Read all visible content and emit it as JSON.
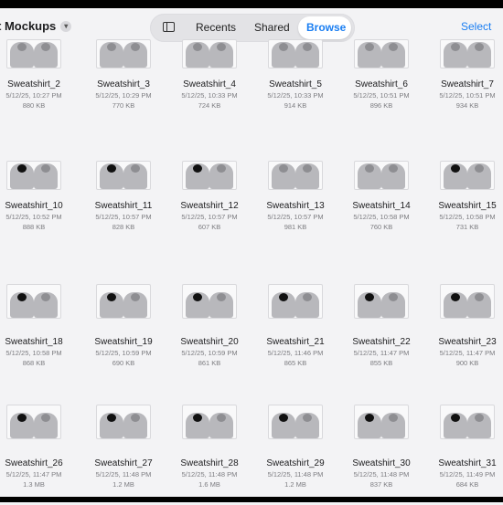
{
  "header": {
    "folder_title": "t Mockups",
    "chevron_icon": "chevron-down-icon",
    "sidebar_icon": "sidebar-icon",
    "segments": [
      "Recents",
      "Shared",
      "Browse"
    ],
    "active_segment": "Browse",
    "select_label": "Select",
    "accent_color": "#1a7ef2"
  },
  "rows": [
    [
      {
        "name": "Sweatshirt_2",
        "date": "5/12/25, 10:27 PM",
        "size": "880 KB"
      },
      {
        "name": "Sweatshirt_3",
        "date": "5/12/25, 10:29 PM",
        "size": "770 KB"
      },
      {
        "name": "Sweatshirt_4",
        "date": "5/12/25, 10:33 PM",
        "size": "724 KB"
      },
      {
        "name": "Sweatshirt_5",
        "date": "5/12/25, 10:33 PM",
        "size": "914 KB"
      },
      {
        "name": "Sweatshirt_6",
        "date": "5/12/25, 10:51 PM",
        "size": "896 KB"
      },
      {
        "name": "Sweatshirt_7",
        "date": "5/12/25, 10:51 PM",
        "size": "934 KB"
      }
    ],
    [
      {
        "name": "Sweatshirt_10",
        "date": "5/12/25, 10:52 PM",
        "size": "888 KB"
      },
      {
        "name": "Sweatshirt_11",
        "date": "5/12/25, 10:57 PM",
        "size": "828 KB"
      },
      {
        "name": "Sweatshirt_12",
        "date": "5/12/25, 10:57 PM",
        "size": "607 KB"
      },
      {
        "name": "Sweatshirt_13",
        "date": "5/12/25, 10:57 PM",
        "size": "981 KB"
      },
      {
        "name": "Sweatshirt_14",
        "date": "5/12/25, 10:58 PM",
        "size": "760 KB"
      },
      {
        "name": "Sweatshirt_15",
        "date": "5/12/25, 10:58 PM",
        "size": "731 KB"
      }
    ],
    [
      {
        "name": "Sweatshirt_18",
        "date": "5/12/25, 10:58 PM",
        "size": "868 KB"
      },
      {
        "name": "Sweatshirt_19",
        "date": "5/12/25, 10:59 PM",
        "size": "690 KB"
      },
      {
        "name": "Sweatshirt_20",
        "date": "5/12/25, 10:59 PM",
        "size": "861 KB"
      },
      {
        "name": "Sweatshirt_21",
        "date": "5/12/25, 11:46 PM",
        "size": "865 KB"
      },
      {
        "name": "Sweatshirt_22",
        "date": "5/12/25, 11:47 PM",
        "size": "855 KB"
      },
      {
        "name": "Sweatshirt_23",
        "date": "5/12/25, 11:47 PM",
        "size": "900 KB"
      }
    ],
    [
      {
        "name": "Sweatshirt_26",
        "date": "5/12/25, 11:47 PM",
        "size": "1.3 MB"
      },
      {
        "name": "Sweatshirt_27",
        "date": "5/12/25, 11:48 PM",
        "size": "1.2 MB"
      },
      {
        "name": "Sweatshirt_28",
        "date": "5/12/25, 11:48 PM",
        "size": "1.6 MB"
      },
      {
        "name": "Sweatshirt_29",
        "date": "5/12/25, 11:48 PM",
        "size": "1.2 MB"
      },
      {
        "name": "Sweatshirt_30",
        "date": "5/12/25, 11:48 PM",
        "size": "837 KB"
      },
      {
        "name": "Sweatshirt_31",
        "date": "5/12/25, 11:49 PM",
        "size": "684 KB"
      }
    ]
  ]
}
